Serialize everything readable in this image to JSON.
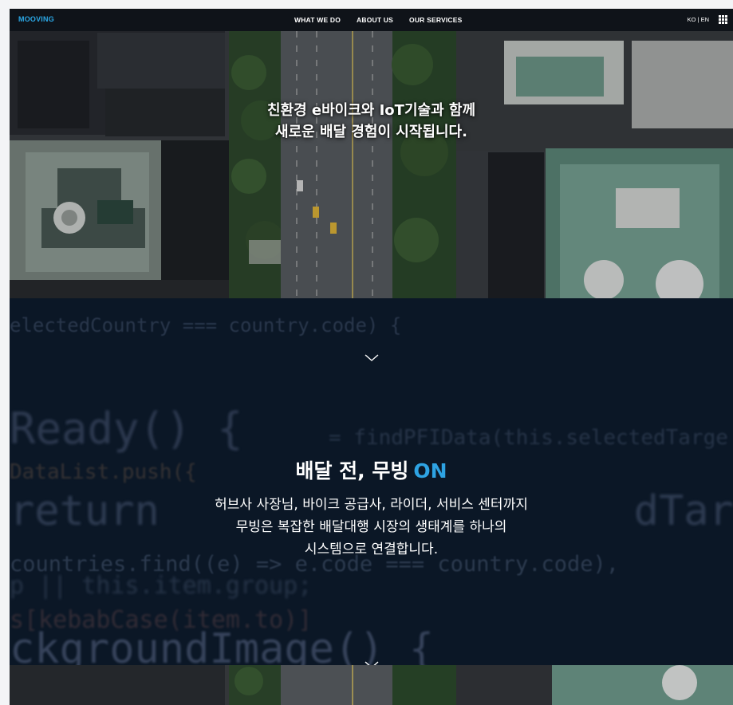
{
  "nav": {
    "logo": "MOOVING",
    "menu": [
      "WHAT WE DO",
      "ABOUT US",
      "OUR SERVICES"
    ],
    "lang": "KO | EN",
    "menu_icon": "grid-icon"
  },
  "hero": {
    "line1": "친환경 e바이크와 IoT기술과 함께",
    "line2": "새로운 배달 경험이 시작됩니다."
  },
  "section": {
    "title_main": "배달 전, 무빙",
    "title_accent": "ON",
    "body_line1": "허브사 사장님, 바이크 공급사, 라이더, 서비스 센터까지",
    "body_line2": "무빙은 복잡한 배달대행 시장의 생태계를 하나의",
    "body_line3": "시스템으로 연결합니다."
  },
  "code_background": {
    "line1": "electedCountry === country.code) {",
    "line2": "Ready() {",
    "line3": "= findPFIData(this.selectedTarge",
    "line4": "DataList.push({",
    "line5": "return",
    "line5b": "dTarget",
    "line6": "countries.find((e) => e.code === country.code),",
    "line7": "p || this.item.group;",
    "line8": "s[kebabCase(item.to)]",
    "line9": "ckgroundImage() {"
  },
  "colors": {
    "accent": "#2ea3e3",
    "dark_bg": "#0b1726",
    "nav_bg": "#080c12"
  }
}
